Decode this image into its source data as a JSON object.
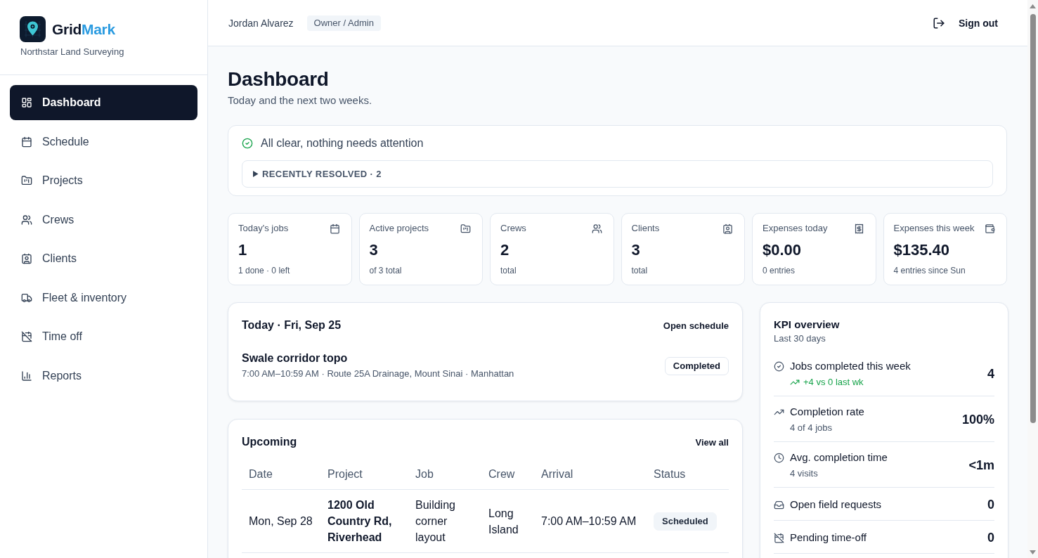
{
  "sidebar": {
    "brand": {
      "name_start": "Grid",
      "name_end": "Mark"
    },
    "org": "Northstar Land Surveying",
    "items": [
      {
        "label": "Dashboard",
        "selected": true
      },
      {
        "label": "Schedule",
        "selected": false
      },
      {
        "label": "Projects",
        "selected": false
      },
      {
        "label": "Crews",
        "selected": false
      },
      {
        "label": "Clients",
        "selected": false
      },
      {
        "label": "Fleet & inventory",
        "selected": false
      },
      {
        "label": "Time off",
        "selected": false
      },
      {
        "label": "Reports",
        "selected": false
      }
    ]
  },
  "header": {
    "user": "Jordan Alvarez",
    "role": "Owner / Admin",
    "sign_out": "Sign out"
  },
  "page": {
    "title": "Dashboard",
    "subtitle": "Today and the next two weeks."
  },
  "alerts": {
    "message": "All clear, nothing needs attention",
    "resolved": {
      "label": "RECENTLY RESOLVED · 2",
      "expanded": false
    }
  },
  "stats": [
    {
      "label": "Today's jobs",
      "value": "1",
      "note": "1 done · 0 left"
    },
    {
      "label": "Active projects",
      "value": "3",
      "note": "of 3 total"
    },
    {
      "label": "Crews",
      "value": "2",
      "note": "total"
    },
    {
      "label": "Clients",
      "value": "3",
      "note": "total"
    },
    {
      "label": "Expenses today",
      "value": "$0.00",
      "note": "0 entries"
    },
    {
      "label": "Expenses this week",
      "value": "$135.40",
      "note": "4 entries since Sun"
    }
  ],
  "today": {
    "title": "Today · Fri, Sep 25",
    "action": "Open schedule",
    "jobs": [
      {
        "name": "Swale corridor topo",
        "details": "7:00 AM–10:59 AM · Route 25A Drainage, Mount Sinai · Manhattan",
        "status": {
          "label": "Completed",
          "kind": "done"
        }
      }
    ]
  },
  "upcoming": {
    "title": "Upcoming",
    "action": "View all",
    "table": {
      "columns": [
        "Date",
        "Project",
        "Job",
        "Crew",
        "Arrival",
        "Status"
      ],
      "rows": [
        {
          "date": "Mon, Sep 28",
          "project": "1200 Old Country Rd, Riverhead",
          "job": "Building corner layout",
          "crew": "Long Island",
          "arrival": "7:00 AM–10:59 AM",
          "status": {
            "label": "Scheduled",
            "kind": "scheduled"
          }
        }
      ]
    }
  },
  "kpi": {
    "title": "KPI overview",
    "period": "Last 30 days",
    "rows": [
      {
        "label": "Jobs completed this week",
        "value": "4",
        "change": {
          "text": "+4 vs 0 last wk",
          "kind": "increase"
        }
      },
      {
        "label": "Completion rate",
        "value": "100%",
        "detail": "4 of 4 jobs"
      },
      {
        "label": "Avg. completion time",
        "value": "<1m",
        "detail": "4 visits"
      },
      {
        "label": "Open field requests",
        "value": "0"
      },
      {
        "label": "Pending time-off",
        "value": "0"
      }
    ]
  }
}
